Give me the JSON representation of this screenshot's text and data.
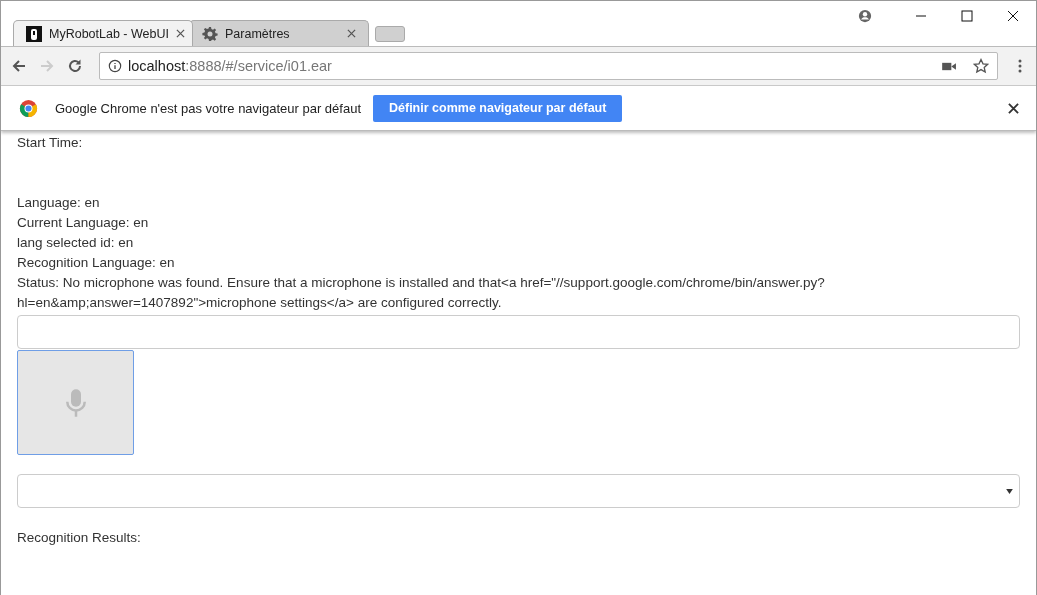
{
  "tabs": [
    {
      "title": "MyRobotLab - WebUI",
      "kind": "robot",
      "selected": true
    },
    {
      "title": "Paramètres",
      "kind": "gear",
      "selected": false
    }
  ],
  "address": {
    "host": "localhost",
    "path": ":8888/#/service/i01.ear"
  },
  "infobar": {
    "message": "Google Chrome n'est pas votre navigateur par défaut",
    "button": "Définir comme navigateur par défaut"
  },
  "content": {
    "start_time": "Start Time:",
    "lines": [
      "Language: en",
      "Current Language: en",
      "lang selected id: en",
      "Recognition Language: en"
    ],
    "status": "Status: No microphone was found. Ensure that a microphone is installed and that<a href=\"//support.google.com/chrome/bin/answer.py?hl=en&amp;answer=1407892\">microphone settings</a> are configured correctly.",
    "results_label": "Recognition Results:"
  }
}
